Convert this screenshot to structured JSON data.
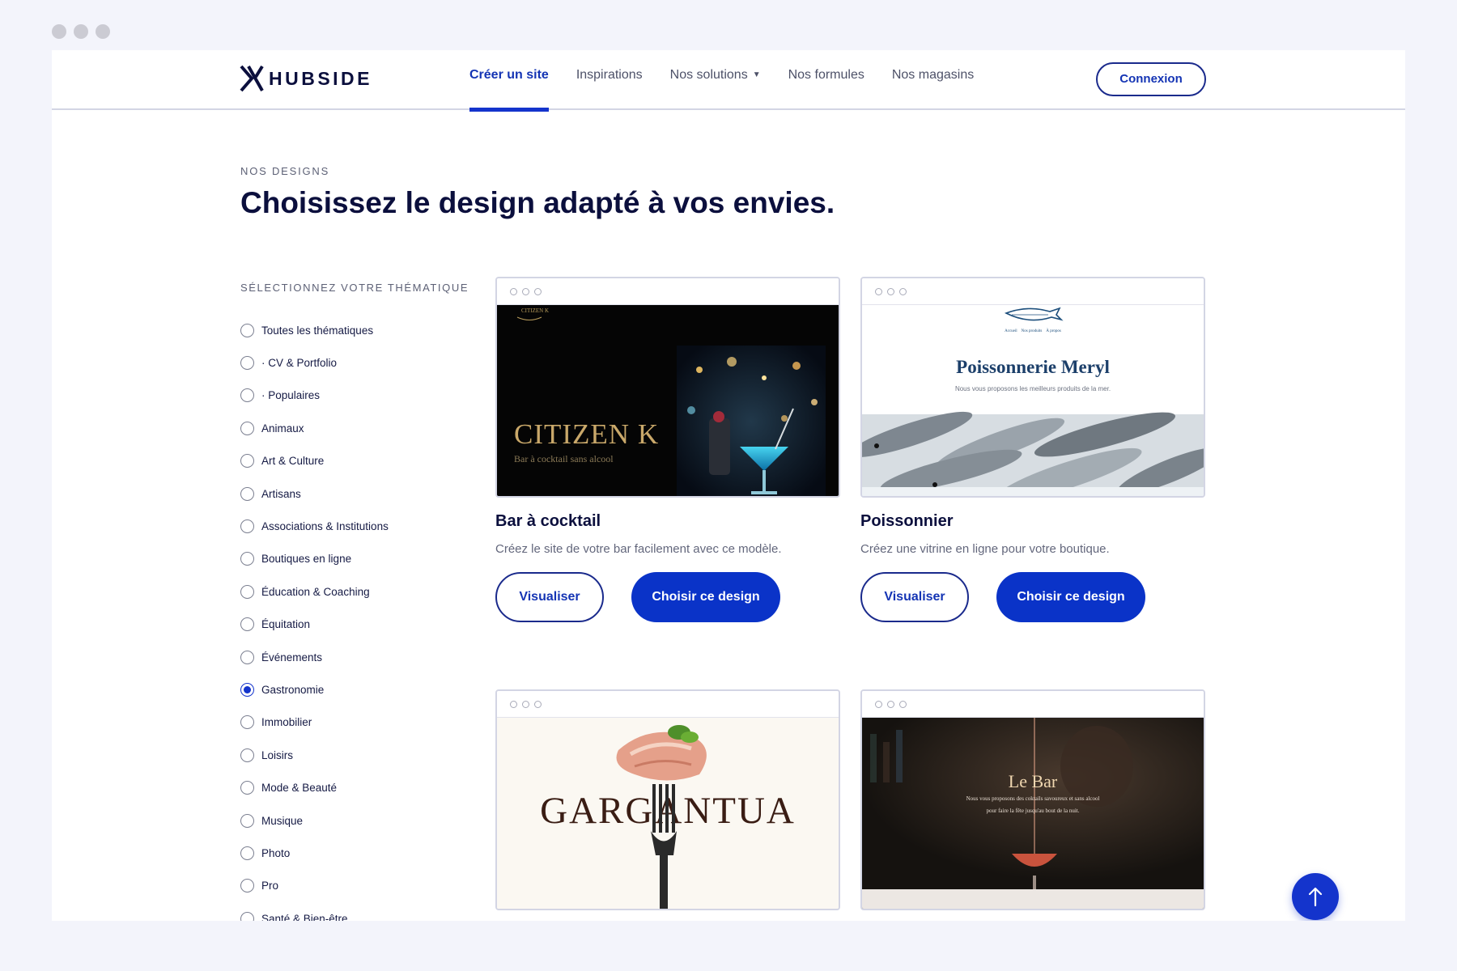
{
  "brand": {
    "name": "HUBSIDE",
    "accent": "#1434cc",
    "ink": "#0b0f3d"
  },
  "nav": {
    "links": [
      {
        "label": "Créer un site",
        "active": true
      },
      {
        "label": "Inspirations"
      },
      {
        "label": "Nos solutions",
        "has_dropdown": true
      },
      {
        "label": "Nos formules"
      },
      {
        "label": "Nos magasins"
      }
    ],
    "login_label": "Connexion"
  },
  "hero": {
    "eyebrow": "NOS DESIGNS",
    "title": "Choisissez le design adapté à vos envies."
  },
  "filters": {
    "title": "SÉLECTIONNEZ VOTRE THÉMATIQUE",
    "items": [
      {
        "label": "Toutes les thématiques",
        "checked": false
      },
      {
        "label": "· CV & Portfolio",
        "checked": false
      },
      {
        "label": "· Populaires",
        "checked": false
      },
      {
        "label": "Animaux",
        "checked": false
      },
      {
        "label": "Art & Culture",
        "checked": false
      },
      {
        "label": "Artisans",
        "checked": false
      },
      {
        "label": "Associations & Institutions",
        "checked": false
      },
      {
        "label": "Boutiques en ligne",
        "checked": false
      },
      {
        "label": "Éducation & Coaching",
        "checked": false
      },
      {
        "label": "Équitation",
        "checked": false
      },
      {
        "label": "Événements",
        "checked": false
      },
      {
        "label": "Gastronomie",
        "checked": true
      },
      {
        "label": "Immobilier",
        "checked": false
      },
      {
        "label": "Loisirs",
        "checked": false
      },
      {
        "label": "Mode & Beauté",
        "checked": false
      },
      {
        "label": "Musique",
        "checked": false
      },
      {
        "label": "Photo",
        "checked": false
      },
      {
        "label": "Pro",
        "checked": false
      },
      {
        "label": "Santé & Bien-être",
        "checked": false
      }
    ]
  },
  "cards": [
    {
      "title": "Bar à cocktail",
      "description": "Créez le site de votre bar facilement avec ce modèle.",
      "preview": {
        "name": "CITIZEN K",
        "tagline": "Bar à cocktail sans alcool",
        "mini_logo": "CITIZEN K"
      },
      "view_label": "Visualiser",
      "choose_label": "Choisir ce design"
    },
    {
      "title": "Poissonnier",
      "description": "Créez une vitrine en ligne pour votre boutique.",
      "preview": {
        "name": "Poissonnerie Meryl",
        "tagline": "Nous vous proposons les meilleurs produits de la mer.",
        "menu": [
          "Accueil",
          "Nos produits",
          "À propos"
        ]
      },
      "view_label": "Visualiser",
      "choose_label": "Choisir ce design"
    },
    {
      "preview": {
        "name": "GARGANTUA"
      }
    },
    {
      "preview": {
        "name": "Le Bar",
        "tagline_1": "Nous vous proposons des coktails savoureux et sans alcool",
        "tagline_2": "pour faire la fête jusqu'au bout de la nuit."
      }
    }
  ],
  "scroll_top_icon": "arrow-up-icon"
}
